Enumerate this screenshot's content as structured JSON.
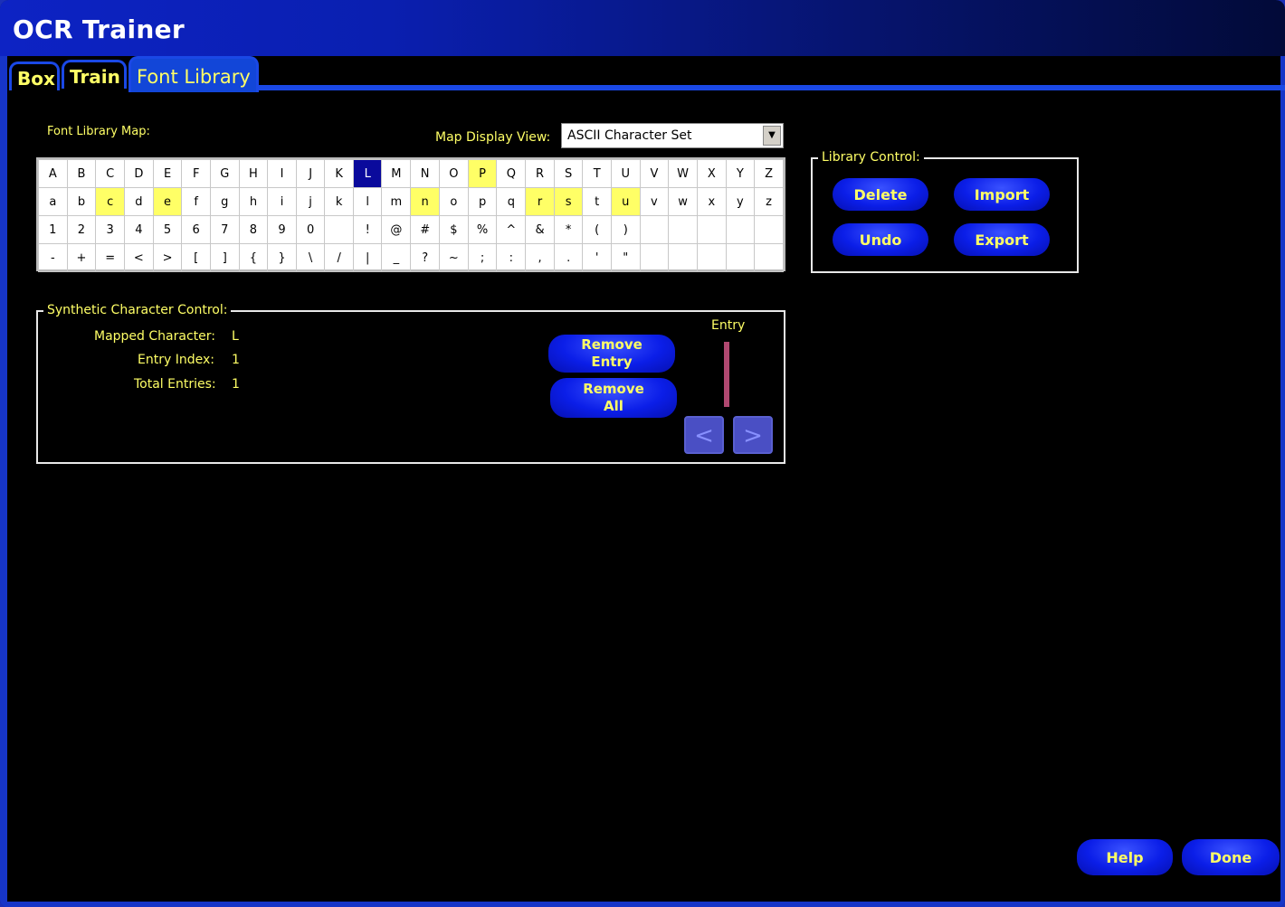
{
  "app": {
    "title": "OCR Trainer"
  },
  "tabs": [
    {
      "label": "Box"
    },
    {
      "label": "Train"
    },
    {
      "label": "Font Library",
      "active": true
    }
  ],
  "font_library_map": {
    "label": "Font Library Map:",
    "display_view_label": "Map Display View:",
    "display_view_value": "ASCII Character Set",
    "rows": [
      [
        "A",
        "B",
        "C",
        "D",
        "E",
        "F",
        "G",
        "H",
        "I",
        "J",
        "K",
        "L",
        "M",
        "N",
        "O",
        "P",
        "Q",
        "R",
        "S",
        "T",
        "U",
        "V",
        "W",
        "X",
        "Y",
        "Z"
      ],
      [
        "a",
        "b",
        "c",
        "d",
        "e",
        "f",
        "g",
        "h",
        "i",
        "j",
        "k",
        "l",
        "m",
        "n",
        "o",
        "p",
        "q",
        "r",
        "s",
        "t",
        "u",
        "v",
        "w",
        "x",
        "y",
        "z"
      ],
      [
        "1",
        "2",
        "3",
        "4",
        "5",
        "6",
        "7",
        "8",
        "9",
        "0",
        "",
        "!",
        "@",
        "#",
        "$",
        "%",
        "^",
        "&",
        "*",
        "(",
        ")",
        "",
        "",
        "",
        "",
        ""
      ],
      [
        "-",
        "+",
        "=",
        "<",
        ">",
        "[",
        "]",
        "{",
        "}",
        "\\",
        "/",
        "|",
        "_",
        "?",
        "~",
        ";",
        ":",
        ",",
        ".",
        "'",
        "\"",
        "",
        "",
        "",
        "",
        ""
      ]
    ],
    "highlighted": [
      "P",
      "c",
      "e",
      "n",
      "r",
      "s",
      "u"
    ],
    "selected": "L",
    "highlight_color": "#ffff66",
    "selected_color": "#0a0a9c"
  },
  "library_control": {
    "legend": "Library Control:",
    "delete_label": "Delete",
    "import_label": "Import",
    "undo_label": "Undo",
    "export_label": "Export"
  },
  "synthetic_control": {
    "legend": "Synthetic Character Control:",
    "mapped_character_label": "Mapped Character:",
    "mapped_character_value": "L",
    "entry_index_label": "Entry Index:",
    "entry_index_value": "1",
    "total_entries_label": "Total Entries:",
    "total_entries_value": "1",
    "remove_entry_label": "Remove Entry",
    "remove_all_label": "Remove All",
    "entry_label": "Entry",
    "prev_glyph": "<",
    "next_glyph": ">"
  },
  "footer": {
    "help_label": "Help",
    "done_label": "Done"
  },
  "colors": {
    "accent_text": "#ffff66",
    "button_blue": "#0b1ee8",
    "background": "#000000"
  }
}
